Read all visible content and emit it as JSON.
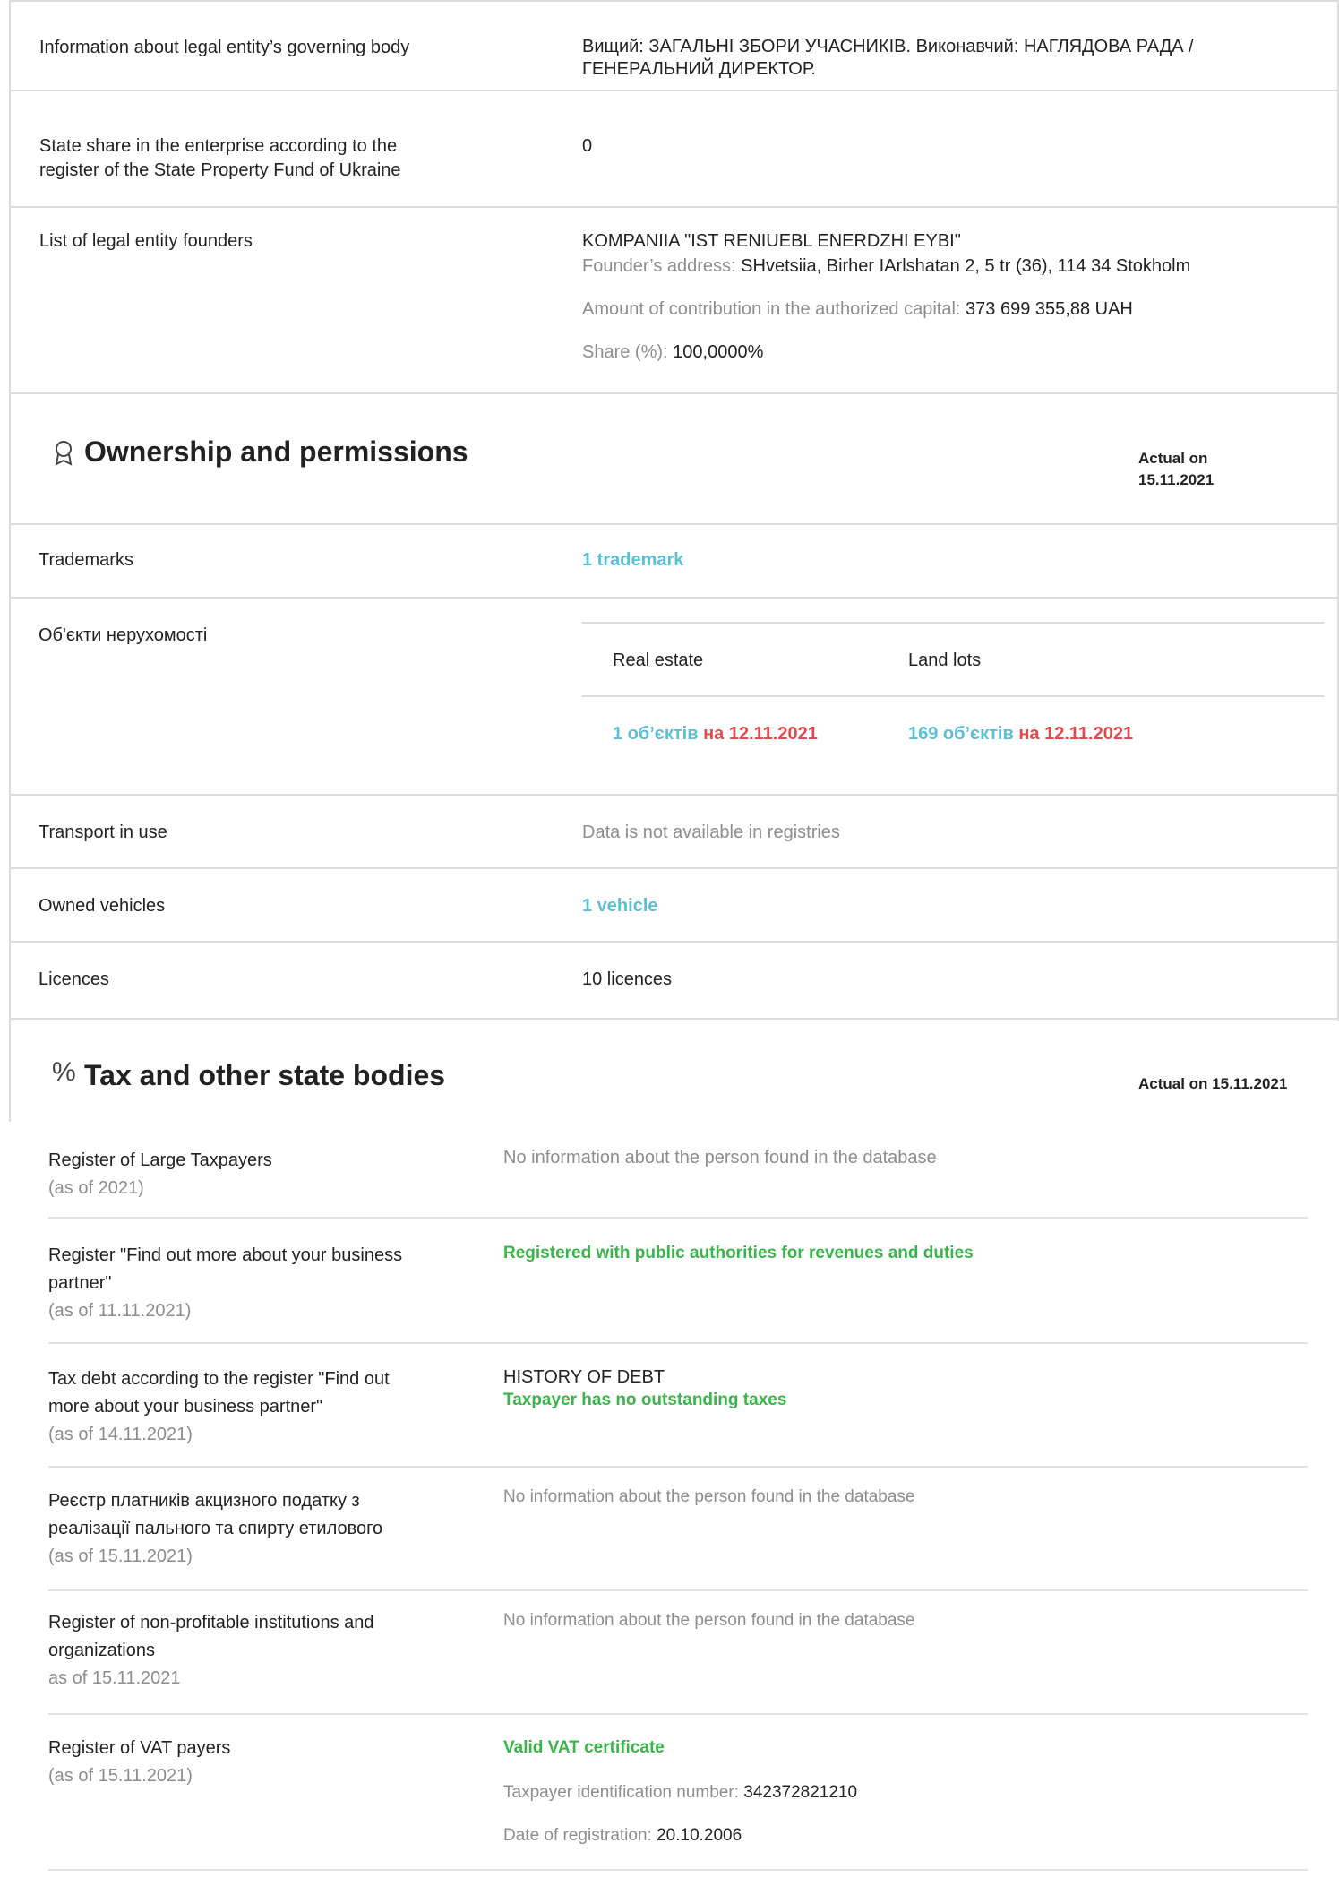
{
  "general": {
    "governing_body": {
      "label": "Information about legal entity’s governing body",
      "value_line1": "Вищий: ЗАГАЛЬНІ ЗБОРИ УЧАСНИКІВ. Виконавчий: НАГЛЯДОВА РАДА /",
      "value_line2": "ГЕНЕРАЛЬНИЙ ДИРЕКТОР."
    },
    "state_share": {
      "label_line1": "State share in the enterprise according to the",
      "label_line2": "register of the State Property Fund of Ukraine",
      "value": "0"
    },
    "founders": {
      "label": "List of legal entity founders",
      "name": "KOMPANIIA \"IST RENIUEBL ENERDZHI EYBI\"",
      "address_label": "Founder’s address:",
      "address_value": "SHvetsiia, Birher IArlshatan 2, 5 tr (36), 114 34 Stokholm",
      "contribution_label": "Amount of contribution in the authorized capital:",
      "contribution_value": "373 699 355,88 UAH",
      "share_label": "Share (%):",
      "share_value": "100,0000%"
    }
  },
  "ownership": {
    "title": "Ownership and permissions",
    "actual_line1": "Actual on",
    "actual_line2": "15.11.2021",
    "trademarks": {
      "label": "Trademarks",
      "value": "1 trademark"
    },
    "real_estate": {
      "label": "Об'єкти нерухомості",
      "col1_header": "Real estate",
      "col2_header": "Land lots",
      "col1_count": "1 об’єктів",
      "col1_date": "на 12.11.2021",
      "col2_count": "169 об’єктів",
      "col2_date": "на 12.11.2021"
    },
    "transport_in_use": {
      "label": "Transport in use",
      "value": "Data is not available in registries"
    },
    "owned_vehicles": {
      "label": "Owned vehicles",
      "value": "1 vehicle"
    },
    "licences": {
      "label": "Licences",
      "value": "10 licences"
    }
  },
  "tax": {
    "title": "Tax and other state bodies",
    "actual": "Actual on 15.11.2021",
    "rows": [
      {
        "label": "Register of Large Taxpayers",
        "asof": "(as of 2021)",
        "value": "No information about the person found in the database"
      },
      {
        "label_line1": "Register \"Find out more about your business",
        "label_line2": "partner\"",
        "asof": "(as of 11.11.2021)",
        "value": "Registered with public authorities for revenues and duties"
      },
      {
        "label_line1": "Tax debt according to the register \"Find out",
        "label_line2": "more about your business partner\"",
        "asof": "(as of 14.11.2021)",
        "value_title": "HISTORY OF DEBT",
        "value": "Taxpayer has no outstanding taxes"
      },
      {
        "label_line1": "Реєстр платників акцизного податку з",
        "label_line2": "реалізації пального та спирту етилового",
        "asof": "(as of 15.11.2021)",
        "value": "No information about the person found in the database"
      },
      {
        "label_line1": "Register of non-profitable institutions and",
        "label_line2": "organizations",
        "asof": "as of 15.11.2021",
        "value": "No information about the person found in the database"
      },
      {
        "label": "Register of VAT payers",
        "asof": "(as of 15.11.2021)",
        "value": "Valid VAT certificate",
        "tin_label": "Taxpayer identification number:",
        "tin_value": "342372821210",
        "date_label": "Date of registration:",
        "date_value": "20.10.2006"
      }
    ]
  },
  "colors": {
    "link": "#5bbfd6",
    "red": "#e24b4b",
    "green": "#3ab54a",
    "muted": "#8d8d8d"
  },
  "icons": {
    "ownership": "award-icon",
    "tax": "percent-icon"
  }
}
